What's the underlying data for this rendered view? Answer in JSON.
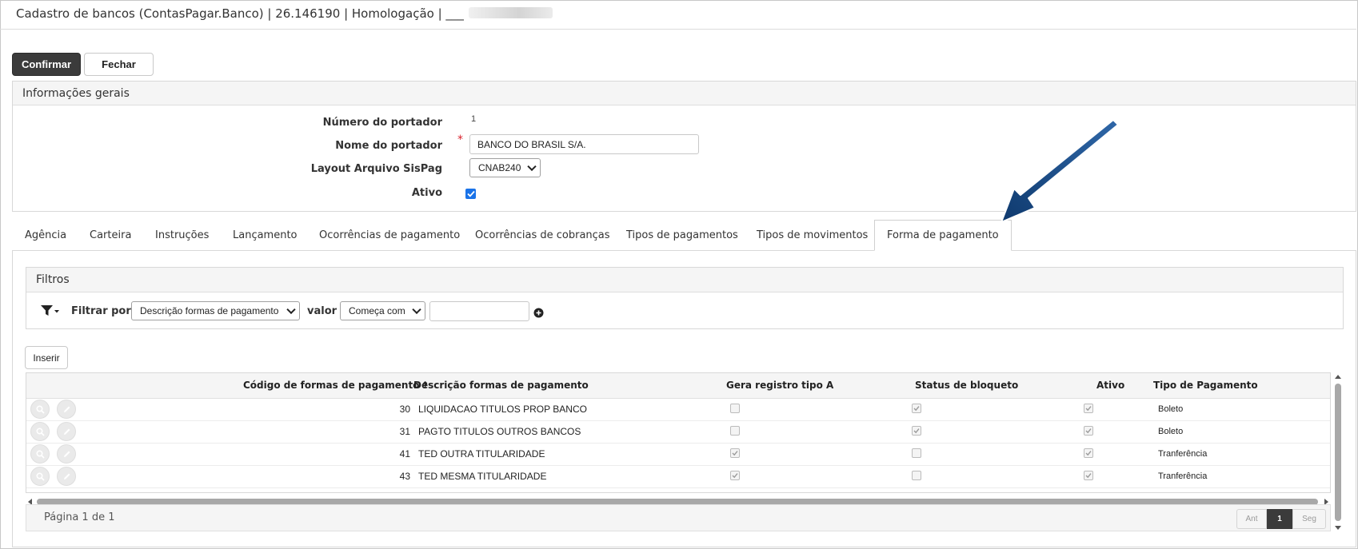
{
  "window": {
    "title": "Cadastro de bancos (ContasPagar.Banco) | 26.146190 | Homologação | ___"
  },
  "toolbar": {
    "confirm_label": "Confirmar",
    "close_label": "Fechar"
  },
  "general": {
    "title": "Informações gerais",
    "fields": {
      "numero_label": "Número do portador",
      "numero_value": "1",
      "nome_label": "Nome do portador",
      "nome_value": "BANCO DO BRASIL S/A.",
      "required_mark": "*",
      "layout_label": "Layout Arquivo SisPag",
      "layout_value": "CNAB240",
      "ativo_label": "Ativo",
      "ativo_checked": true
    }
  },
  "tabs": [
    {
      "label": "Agência"
    },
    {
      "label": "Carteira"
    },
    {
      "label": "Instruções"
    },
    {
      "label": "Lançamento"
    },
    {
      "label": "Ocorrências de pagamento"
    },
    {
      "label": "Ocorrências de cobranças"
    },
    {
      "label": "Tipos de pagamentos"
    },
    {
      "label": "Tipos de movimentos"
    },
    {
      "label": "Forma de pagamento",
      "active": true
    }
  ],
  "filters": {
    "title": "Filtros",
    "filter_by_label": "Filtrar por",
    "field_value": "Descrição formas de pagamento",
    "valor_label": "valor",
    "operator_value": "Começa com",
    "text_value": ""
  },
  "insert_label": "Inserir",
  "table": {
    "columns": [
      "Código de formas de pagamento",
      "Descrição formas de pagamento",
      "Gera registro tipo A",
      "Status de bloqueto",
      "Ativo",
      "Tipo de Pagamento"
    ],
    "sort_indicator": "↑",
    "rows": [
      {
        "codigo": "30",
        "descricao": "LIQUIDACAO TITULOS PROP BANCO",
        "gera_registro": false,
        "status_bloqueto": true,
        "ativo": true,
        "tipo": "Boleto"
      },
      {
        "codigo": "31",
        "descricao": "PAGTO TITULOS OUTROS BANCOS",
        "gera_registro": false,
        "status_bloqueto": true,
        "ativo": true,
        "tipo": "Boleto"
      },
      {
        "codigo": "41",
        "descricao": "TED OUTRA TITULARIDADE",
        "gera_registro": true,
        "status_bloqueto": false,
        "ativo": true,
        "tipo": "Tranferência"
      },
      {
        "codigo": "43",
        "descricao": "TED MESMA TITULARIDADE",
        "gera_registro": true,
        "status_bloqueto": false,
        "ativo": true,
        "tipo": "Tranferência"
      }
    ]
  },
  "pagination": {
    "label": "Página 1 de 1",
    "prev": "Ant",
    "current": "1",
    "next": "Seg"
  },
  "colors": {
    "arrow": "#1f4e8c",
    "primary_button": "#3b3b3b"
  },
  "icons": [
    "filter-icon",
    "add-filter-icon",
    "view-icon",
    "edit-icon",
    "annotation-arrow"
  ]
}
